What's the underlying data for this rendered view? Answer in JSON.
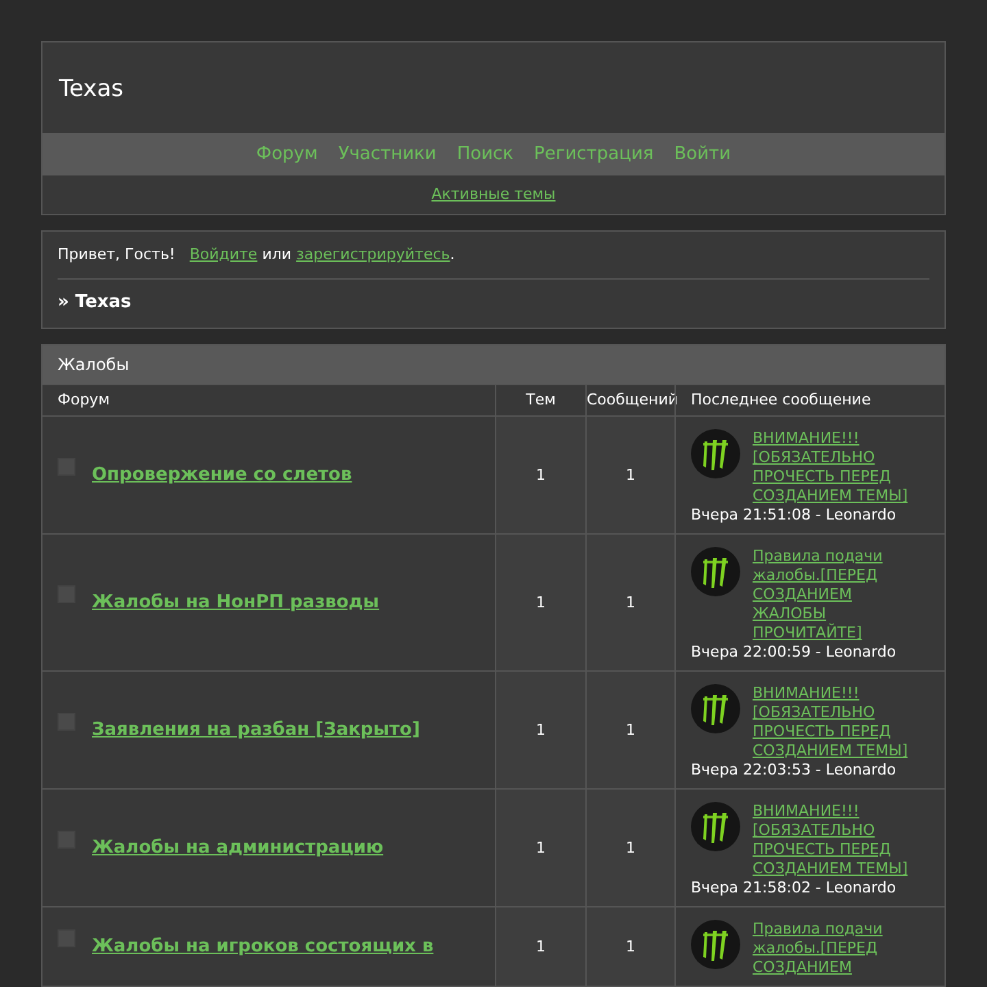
{
  "site_title": "Texas",
  "nav": [
    {
      "label": "Форум"
    },
    {
      "label": "Участники"
    },
    {
      "label": "Поиск"
    },
    {
      "label": "Регистрация"
    },
    {
      "label": "Войти"
    }
  ],
  "subnav": {
    "label": "Активные темы"
  },
  "welcome": {
    "greeting": "Привет, Гость!",
    "login_link": "Войдите",
    "joiner": "или",
    "register_link": "зарегистрируйтесь",
    "end": "."
  },
  "breadcrumb": "» Texas",
  "category": {
    "title": "Жалобы",
    "columns": [
      "Форум",
      "Тем",
      "Сообщений",
      "Последнее сообщение"
    ],
    "rows": [
      {
        "name": "Опровержение со слетов",
        "topics": "1",
        "posts": "1",
        "last_post": "ВНИМАНИЕ!!! [ОБЯЗАТЕЛЬНО ПРОЧЕСТЬ ПЕРЕД СОЗДАНИЕМ ТЕМЫ]",
        "last_meta": "Вчера 21:51:08 - Leonardo"
      },
      {
        "name": "Жалобы на НонРП разводы",
        "topics": "1",
        "posts": "1",
        "last_post": "Правила подачи жалобы.[ПЕРЕД СОЗДАНИЕМ ЖАЛОБЫ ПРОЧИТАЙТЕ]",
        "last_meta": "Вчера 22:00:59 - Leonardo"
      },
      {
        "name": "Заявления на разбан [Закрыто]",
        "topics": "1",
        "posts": "1",
        "last_post": "ВНИМАНИЕ!!! [ОБЯЗАТЕЛЬНО ПРОЧЕСТЬ ПЕРЕД СОЗДАНИЕМ ТЕМЫ]",
        "last_meta": "Вчера 22:03:53 - Leonardo"
      },
      {
        "name": "Жалобы на администрацию",
        "topics": "1",
        "posts": "1",
        "last_post": "ВНИМАНИЕ!!! [ОБЯЗАТЕЛЬНО ПРОЧЕСТЬ ПЕРЕД СОЗДАНИЕМ ТЕМЫ]",
        "last_meta": "Вчера 21:58:02 - Leonardo"
      },
      {
        "name": "Жалобы на игроков состоящих в",
        "topics": "1",
        "posts": "1",
        "last_post": "Правила подачи жалобы.[ПЕРЕД СОЗДАНИЕМ"
      }
    ]
  }
}
